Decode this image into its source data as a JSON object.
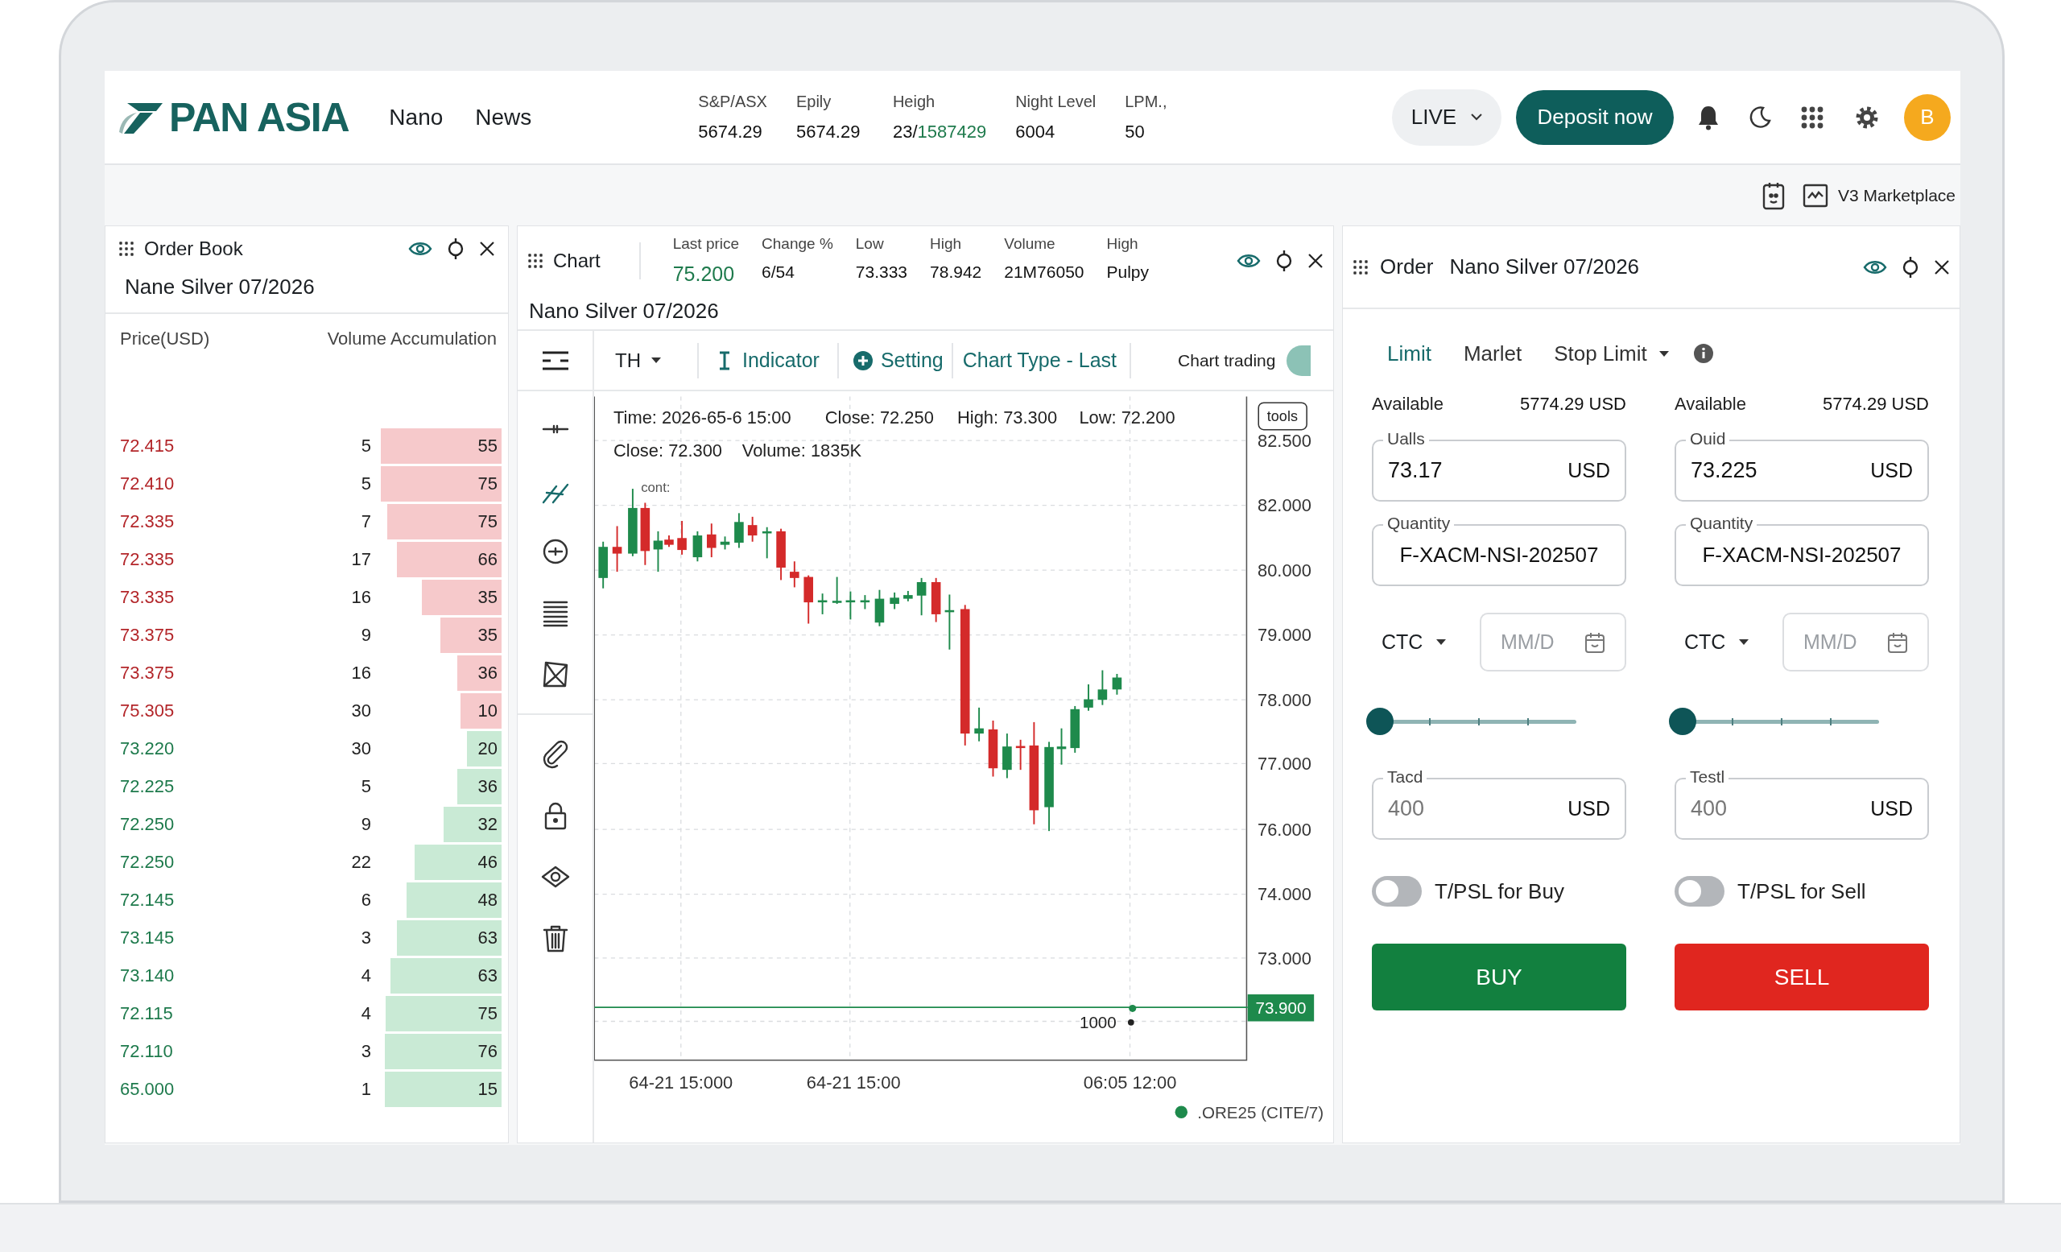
{
  "header": {
    "logo": "PAN ASIA",
    "nav": [
      {
        "label": "Nano"
      },
      {
        "label": "News"
      }
    ],
    "stats": [
      {
        "label": "S&P/ASX",
        "value": "5674.29"
      },
      {
        "label": "Epily",
        "value": "5674.29"
      },
      {
        "label": "Heigh",
        "value": "23/",
        "value_green": "1587429"
      },
      {
        "label": "Night Level",
        "value": "6004"
      },
      {
        "label": "LPM.,",
        "value": "50"
      }
    ],
    "mode": "LIVE",
    "deposit_button": "Deposit now",
    "avatar": "B"
  },
  "subbar": {
    "marketplace": "V3 Marketplace"
  },
  "order_book": {
    "title": "Order Book",
    "instrument": "Nane Silver 07/2026",
    "columns": [
      "Price(USD)",
      "Volume Accumulation"
    ],
    "rows": [
      {
        "price": "72.415",
        "volume": "5",
        "accumulation": "55",
        "kind": "ask"
      },
      {
        "price": "72.410",
        "volume": "5",
        "accumulation": "75",
        "kind": "ask"
      },
      {
        "price": "72.335",
        "volume": "7",
        "accumulation": "75",
        "kind": "ask"
      },
      {
        "price": "72.335",
        "volume": "17",
        "accumulation": "66",
        "kind": "ask"
      },
      {
        "price": "73.335",
        "volume": "16",
        "accumulation": "35",
        "kind": "ask"
      },
      {
        "price": "73.375",
        "volume": "9",
        "accumulation": "35",
        "kind": "ask"
      },
      {
        "price": "73.375",
        "volume": "16",
        "accumulation": "36",
        "kind": "ask"
      },
      {
        "price": "75.305",
        "volume": "30",
        "accumulation": "10",
        "kind": "ask"
      },
      {
        "price": "73.220",
        "volume": "30",
        "accumulation": "20",
        "kind": "bid"
      },
      {
        "price": "72.225",
        "volume": "5",
        "accumulation": "36",
        "kind": "bid"
      },
      {
        "price": "72.250",
        "volume": "9",
        "accumulation": "32",
        "kind": "bid"
      },
      {
        "price": "72.250",
        "volume": "22",
        "accumulation": "46",
        "kind": "bid"
      },
      {
        "price": "72.145",
        "volume": "6",
        "accumulation": "48",
        "kind": "bid"
      },
      {
        "price": "73.145",
        "volume": "3",
        "accumulation": "63",
        "kind": "bid"
      },
      {
        "price": "73.140",
        "volume": "4",
        "accumulation": "63",
        "kind": "bid"
      },
      {
        "price": "72.115",
        "volume": "4",
        "accumulation": "75",
        "kind": "bid"
      },
      {
        "price": "72.110",
        "volume": "3",
        "accumulation": "76",
        "kind": "bid"
      },
      {
        "price": "65.000",
        "volume": "1",
        "accumulation": "15",
        "kind": "bid"
      }
    ]
  },
  "chart": {
    "title": "Chart",
    "stats": [
      {
        "label": "Last price",
        "value": "75.200",
        "kind": "price"
      },
      {
        "label": "Change %",
        "value": "6/54",
        "kind": "plain"
      },
      {
        "label": "Low",
        "value": "73.333",
        "kind": "plain"
      },
      {
        "label": "High",
        "value": "78.942",
        "kind": "plain"
      },
      {
        "label": "Volume",
        "value": "21M76050",
        "kind": "plain"
      },
      {
        "label": "High",
        "value": "Pulpy",
        "kind": "plain"
      }
    ],
    "instrument": "Nano Silver 07/2026",
    "toolbar": {
      "interval": "TH",
      "indicator": "Indicator",
      "setting": "Setting",
      "chart_type": "Chart Type - Last",
      "chart_trading": "Chart trading",
      "chart_trading_on": true
    },
    "ohlc": [
      "Time: 2026-65-6 15:00",
      "Close: 72.250",
      "High: 73.300",
      "Low: 72.200",
      "Close: 72.300",
      "Volume: 1835K"
    ],
    "annotation": "cont:",
    "tools_button": "tools",
    "y_labels": [
      "82.500",
      "82.000",
      "80.000",
      "79.000",
      "78.000",
      "77.000",
      "76.000",
      "74.000",
      "73.000"
    ],
    "last_price": "73.900",
    "order_label": "1000",
    "x_labels": [
      "64-21 15:000",
      "64-21 15:00",
      "06:05 12:00"
    ],
    "legend": ".ORE25 (CITE/7)"
  },
  "order": {
    "title": "Order",
    "instrument": "Nano Silver 07/2026",
    "tabs": [
      {
        "label": "Limit",
        "selected": true,
        "dropdown": false
      },
      {
        "label": "Marlet",
        "selected": false,
        "dropdown": false
      },
      {
        "label": "Stop Limit",
        "selected": false,
        "dropdown": true
      }
    ],
    "sides": [
      {
        "kind": "buy",
        "available_label": "Available",
        "available": "5774.29 USD",
        "price_label": "Ualls",
        "price": "73.17",
        "price_unit": "USD",
        "quantity_label": "Quantity",
        "quantity": "F-XACM-NSI-202507",
        "order_type": "CTC",
        "date_placeholder": "MM/D",
        "slider": {
          "level": 0
        },
        "amount_label": "Tacd",
        "amount_placeholder": "400",
        "amount_unit": "USD",
        "tpsl": {
          "label": "T/PSL for Buy",
          "on": false
        },
        "button": "BUY"
      },
      {
        "kind": "sell",
        "available_label": "Available",
        "available": "5774.29 USD",
        "price_label": "Ouid",
        "price": "73.225",
        "price_unit": "USD",
        "quantity_label": "Quantity",
        "quantity": "F-XACM-NSI-202507",
        "order_type": "CTC",
        "date_placeholder": "MM/D",
        "slider": {
          "level": 0
        },
        "amount_label": "Testl",
        "amount_placeholder": "400",
        "amount_unit": "USD",
        "tpsl": {
          "label": "T/PSL for Sell",
          "on": false
        },
        "button": "SELL"
      }
    ]
  }
}
